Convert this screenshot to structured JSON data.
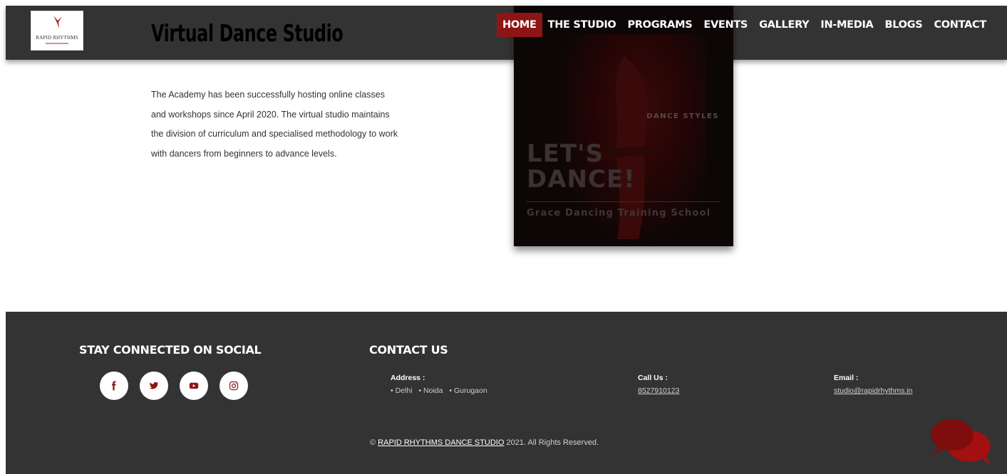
{
  "brand": {
    "logo_text": "RAPID RHYTHMS",
    "site_title": "Virtual Dance Studio",
    "accent_color": "#8e1515",
    "header_color": "#333333"
  },
  "nav": {
    "items": [
      {
        "label": "HOME",
        "active": true
      },
      {
        "label": "THE STUDIO",
        "active": false
      },
      {
        "label": "PROGRAMS",
        "active": false
      },
      {
        "label": "EVENTS",
        "active": false
      },
      {
        "label": "GALLERY",
        "active": false
      },
      {
        "label": "IN-MEDIA",
        "active": false
      },
      {
        "label": "BLOGS",
        "active": false
      },
      {
        "label": "CONTACT",
        "active": false
      }
    ]
  },
  "main": {
    "intro_text": "The Academy has been successfully hosting online classes and workshops since April 2020. The virtual studio maintains the division of curriculum and specialised methodology to work with dancers from beginners to advance levels."
  },
  "poster": {
    "styles_title": "DANCE STYLES",
    "headline_line1": "LET'S",
    "headline_line2": "DANCE!",
    "school_name": "Grace Dancing Training School"
  },
  "footer": {
    "social_title": "STAY CONNECTED ON SOCIAL",
    "social_icons": [
      "facebook-icon",
      "twitter-icon",
      "youtube-icon",
      "instagram-icon"
    ],
    "contact_title": "CONTACT US",
    "address_label": "Address :",
    "address_items": [
      "• Delhi",
      "• Noida",
      "• Gurugaon"
    ],
    "call_label": "Call Us :",
    "call_value": "8527910123",
    "email_label": "Email :",
    "email_value": "studio@rapidrhythms.in",
    "copyright_prefix": "©",
    "copyright_brand": "RAPID RHYTHMS DANCE STUDIO",
    "copyright_suffix": "2021. All Rights Reserved."
  }
}
